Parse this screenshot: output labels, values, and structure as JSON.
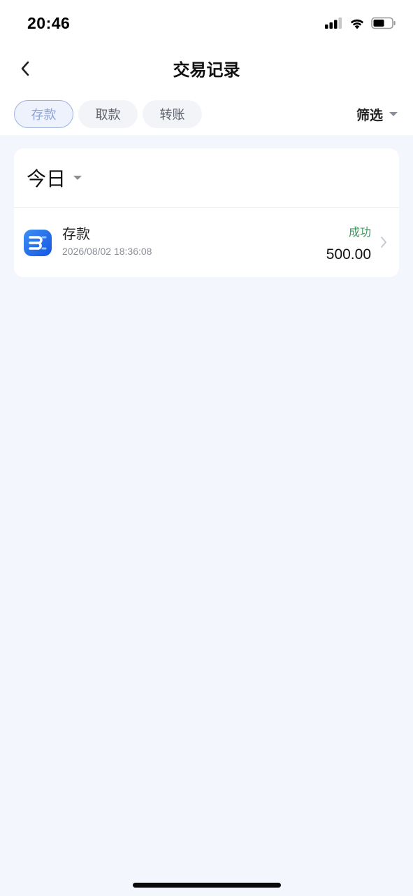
{
  "status_bar": {
    "time": "20:46",
    "icons": [
      "signal-icon",
      "wifi-icon",
      "battery-icon"
    ]
  },
  "header": {
    "title": "交易记录",
    "back_icon": "back-chevron-icon"
  },
  "tabs": [
    {
      "label": "存款",
      "active": true
    },
    {
      "label": "取款",
      "active": false
    },
    {
      "label": "转账",
      "active": false
    }
  ],
  "filter": {
    "label": "筛选",
    "icon": "caret-down-icon"
  },
  "group": {
    "date_label": "今日",
    "transactions": [
      {
        "type": "存款",
        "datetime": "2026/08/02 18:36:08",
        "status": "成功",
        "amount": "500.00",
        "icon": "app-logo-icon"
      }
    ]
  },
  "colors": {
    "page_background": "#f3f6fc",
    "active_tab_text": "#8fa3d8",
    "status_success": "#3a9a5c",
    "logo_blue": "#1f6ef0"
  }
}
